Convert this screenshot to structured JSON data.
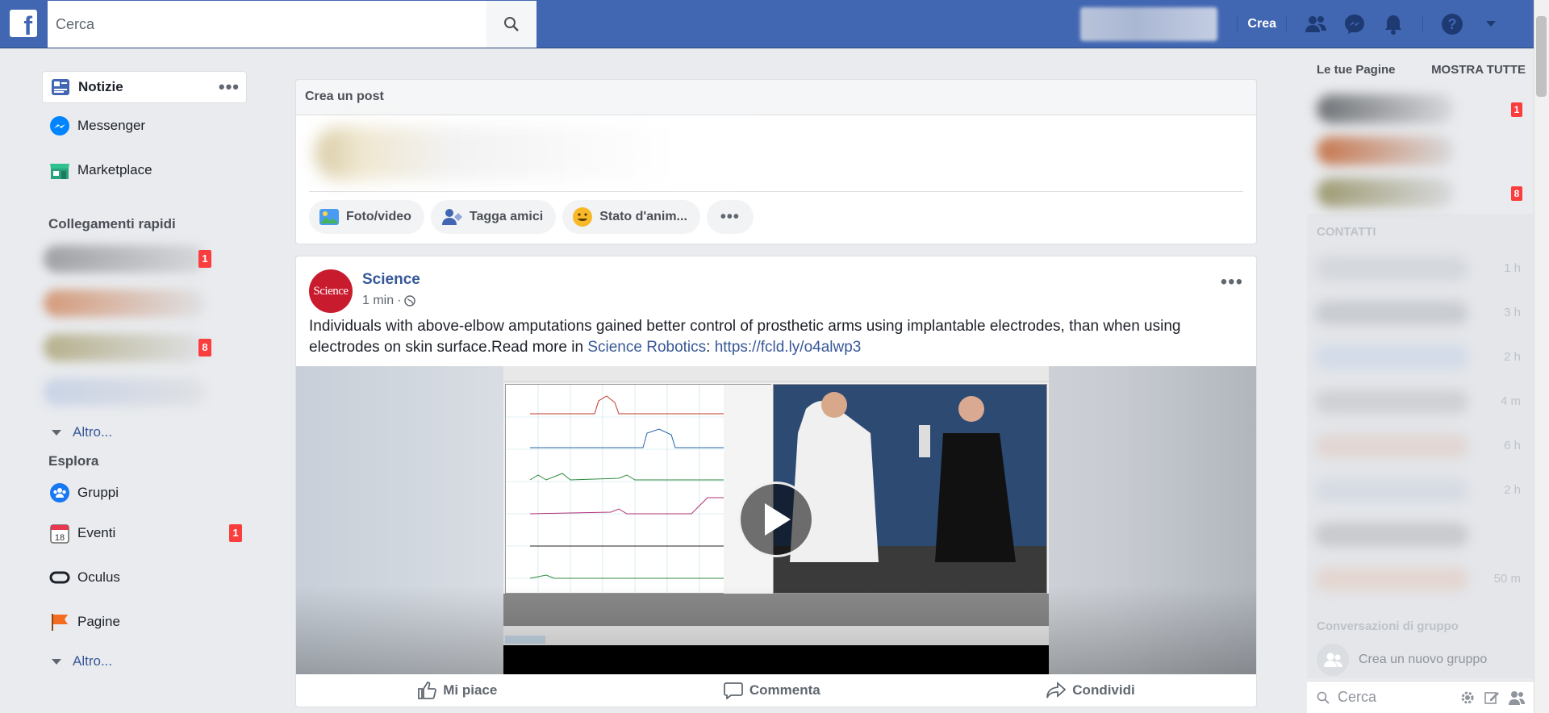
{
  "topbar": {
    "logo": "f",
    "search_placeholder": "Cerca",
    "create_label": "Crea"
  },
  "colors": {
    "brand": "#4267b2",
    "link": "#385898",
    "badge": "#fa3e3e",
    "science_red": "#c91b2e"
  },
  "leftnav": {
    "items": [
      {
        "label": "Notizie",
        "icon": "news-feed-icon"
      },
      {
        "label": "Messenger",
        "icon": "messenger-icon"
      },
      {
        "label": "Marketplace",
        "icon": "marketplace-icon"
      }
    ],
    "shortcuts_title": "Collegamenti rapidi",
    "shortcut_badges": [
      "1",
      "8"
    ],
    "more_label": "Altro...",
    "explore_title": "Esplora",
    "explore_items": [
      {
        "label": "Gruppi",
        "icon": "groups-icon"
      },
      {
        "label": "Eventi",
        "icon": "events-icon",
        "badge": "1"
      },
      {
        "label": "Oculus",
        "icon": "oculus-icon"
      },
      {
        "label": "Pagine",
        "icon": "pages-flag-icon"
      }
    ],
    "explore_more_label": "Altro..."
  },
  "composer": {
    "title": "Crea un post",
    "actions": [
      "Foto/video",
      "Tagga amici",
      "Stato d'anim..."
    ]
  },
  "post": {
    "author": "Science",
    "avatar_text": "Science",
    "time": "1 min",
    "text_main": "Individuals with above-elbow amputations gained better control of prosthetic arms using implantable electrodes, than when using electrodes on skin surface.Read more in ",
    "text_link": "Science Robotics",
    "text_sep": ": ",
    "url": "https://fcld.ly/o4alwp3",
    "actions": [
      "Mi piace",
      "Commenta",
      "Condividi"
    ]
  },
  "rightbar": {
    "pages_title": "Le tue Pagine",
    "show_all": "MOSTRA TUTTE",
    "page_badges": [
      "1",
      "",
      "8"
    ],
    "contacts_title": "CONTATTI",
    "contact_times": [
      "1 h",
      "3 h",
      "2 h",
      "4 m",
      "6 h",
      "2 h",
      "",
      "50 m"
    ],
    "group_conv_title": "Conversazioni di gruppo",
    "new_group": "Crea un nuovo gruppo",
    "search_placeholder": "Cerca"
  }
}
